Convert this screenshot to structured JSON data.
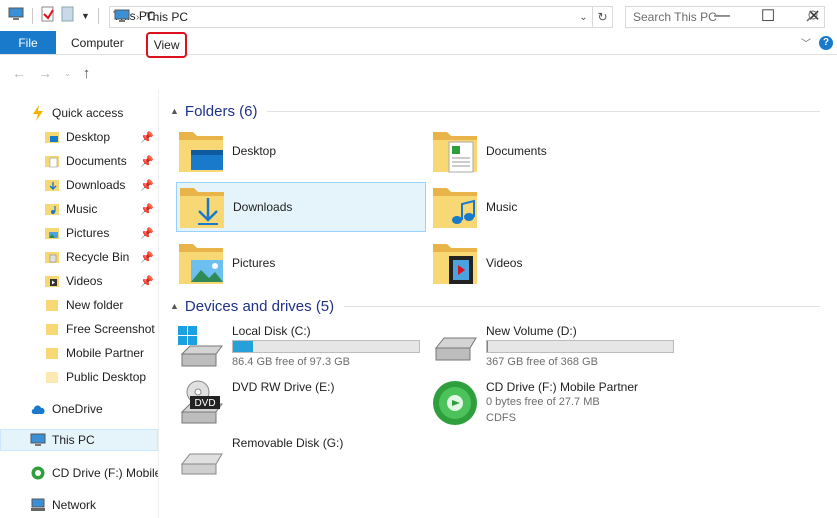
{
  "window": {
    "title": "This PC",
    "minimize": "—",
    "maximize": "☐",
    "close": "✕"
  },
  "ribbon": {
    "tabs": [
      "File",
      "Computer",
      "View"
    ],
    "collapse_icon": "chevron-down",
    "help": "?"
  },
  "address": {
    "path_item": "This PC",
    "search_placeholder": "Search This PC"
  },
  "nav": {
    "quick_access": "Quick access",
    "pinned": [
      {
        "label": "Desktop",
        "icon": "desktop-folder"
      },
      {
        "label": "Documents",
        "icon": "documents-folder"
      },
      {
        "label": "Downloads",
        "icon": "downloads-folder"
      },
      {
        "label": "Music",
        "icon": "music-folder"
      },
      {
        "label": "Pictures",
        "icon": "pictures-folder"
      },
      {
        "label": "Recycle Bin",
        "icon": "recycle-bin"
      },
      {
        "label": "Videos",
        "icon": "videos-folder"
      }
    ],
    "recent": [
      "New folder",
      "Free Screenshot C",
      "Mobile Partner",
      "Public Desktop"
    ],
    "onedrive": "OneDrive",
    "this_pc": "This PC",
    "cd_drive": "CD Drive (F:) Mobile",
    "network": "Network"
  },
  "folders": {
    "header": "Folders (6)",
    "items": [
      {
        "label": "Desktop",
        "icon": "desktop-folder"
      },
      {
        "label": "Documents",
        "icon": "documents-folder"
      },
      {
        "label": "Downloads",
        "icon": "downloads-folder"
      },
      {
        "label": "Music",
        "icon": "music-folder"
      },
      {
        "label": "Pictures",
        "icon": "pictures-folder"
      },
      {
        "label": "Videos",
        "icon": "videos-folder"
      }
    ]
  },
  "drives": {
    "header": "Devices and drives (5)",
    "items": [
      {
        "name": "Local Disk (C:)",
        "free": "86.4 GB free of 97.3 GB",
        "used_fraction": 0.11
      },
      {
        "name": "New Volume (D:)",
        "free": "367 GB free of 368 GB",
        "used_fraction": 0.003
      },
      {
        "name": "DVD RW Drive (E:)",
        "badge": "DVD"
      },
      {
        "name": "CD Drive (F:) Mobile Partner",
        "free": "0 bytes free of 27.7 MB",
        "fs": "CDFS"
      },
      {
        "name": "Removable Disk (G:)"
      }
    ]
  },
  "colors": {
    "accent": "#1979ca",
    "folder": "#f8d775",
    "bar_fill": "#26a0da",
    "selection": "#e5f3fb",
    "view_highlight": "#d9121e"
  }
}
